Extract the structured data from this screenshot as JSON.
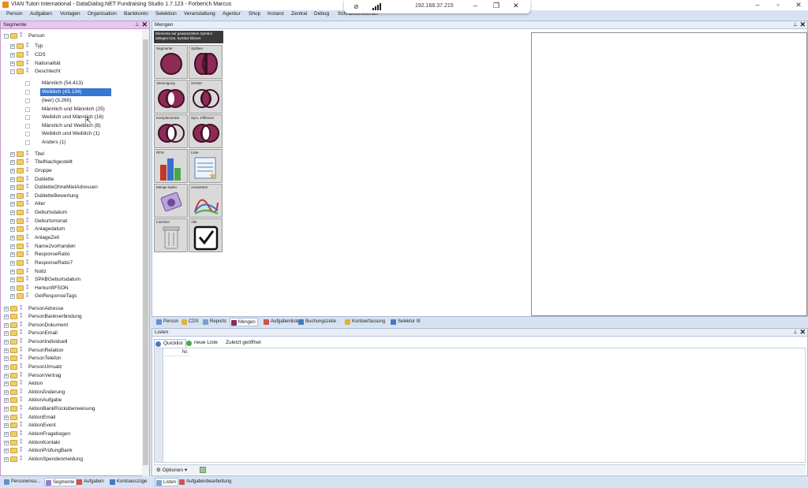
{
  "window": {
    "title": "VIAN Tutori International - DataDialog.NET Fundraising Studio 1.7.123 - Forberich Marcus"
  },
  "menu": [
    "Person",
    "Aufgaben",
    "Vorlagen",
    "Organisation",
    "Bankkonto",
    "Selektion",
    "Veranstaltung",
    "Agentur",
    "Shop",
    "Instanz",
    "Zentral",
    "Debug",
    "Schnellfunktionen"
  ],
  "remote": {
    "ip": "192.168.37.215"
  },
  "segmente": {
    "title": "Segmente",
    "tree": [
      {
        "label": "Person",
        "level": 0,
        "exp": "-"
      },
      {
        "label": "Typ",
        "level": 1,
        "exp": "+"
      },
      {
        "label": "CDS",
        "level": 1,
        "exp": "+"
      },
      {
        "label": "Nationalität",
        "level": 1,
        "exp": "+"
      },
      {
        "label": "Geschlecht",
        "level": 1,
        "exp": "-"
      },
      {
        "label": "Männlich (54.413)",
        "level": 2
      },
      {
        "label": "Weiblich (43.134)",
        "level": 2,
        "selected": true
      },
      {
        "label": "(leer) (3.260)",
        "level": 2
      },
      {
        "label": "Männlich und Männlich (25)",
        "level": 2
      },
      {
        "label": "Weiblich und Männlich (16)",
        "level": 2
      },
      {
        "label": "Männlich und Weiblich (8)",
        "level": 2
      },
      {
        "label": "Weiblich und Weiblich (1)",
        "level": 2
      },
      {
        "label": "Anders (1)",
        "level": 2
      },
      {
        "label": "Titel",
        "level": 1,
        "exp": "+"
      },
      {
        "label": "TitelNachgestellt",
        "level": 1,
        "exp": "+"
      },
      {
        "label": "Gruppe",
        "level": 1,
        "exp": "+"
      },
      {
        "label": "Dublette",
        "level": 1,
        "exp": "+"
      },
      {
        "label": "DubletteOhneMietAdressen",
        "level": 1,
        "exp": "+"
      },
      {
        "label": "DubletteBewertung",
        "level": 1,
        "exp": "+"
      },
      {
        "label": "Alter",
        "level": 1,
        "exp": "+"
      },
      {
        "label": "Geburtsdatum",
        "level": 1,
        "exp": "+"
      },
      {
        "label": "Geburtsmonat",
        "level": 1,
        "exp": "+"
      },
      {
        "label": "Anlagedatum",
        "level": 1,
        "exp": "+"
      },
      {
        "label": "AnlageZeit",
        "level": 1,
        "exp": "+"
      },
      {
        "label": "Name2vorhanden",
        "level": 1,
        "exp": "+"
      },
      {
        "label": "ResponseRatio",
        "level": 1,
        "exp": "+"
      },
      {
        "label": "ResponseRatio7",
        "level": 1,
        "exp": "+"
      },
      {
        "label": "Notiz",
        "level": 1,
        "exp": "+"
      },
      {
        "label": "SPABGeburtsdatum",
        "level": 1,
        "exp": "+"
      },
      {
        "label": "HerkunftFSON",
        "level": 1,
        "exp": "+"
      },
      {
        "label": "GetResponseTags",
        "level": 1,
        "exp": "+"
      },
      {
        "label": "PersonAdresse",
        "level": 0,
        "exp": "+"
      },
      {
        "label": "PersonBankverbindung",
        "level": 0,
        "exp": "+"
      },
      {
        "label": "PersonDokument",
        "level": 0,
        "exp": "+"
      },
      {
        "label": "PersonEmail",
        "level": 0,
        "exp": "+"
      },
      {
        "label": "PersonIndividuell",
        "level": 0,
        "exp": "+"
      },
      {
        "label": "PersonRelation",
        "level": 0,
        "exp": "+"
      },
      {
        "label": "PersonTelefon",
        "level": 0,
        "exp": "+"
      },
      {
        "label": "PersonUmsatz",
        "level": 0,
        "exp": "+"
      },
      {
        "label": "PersonVertrag",
        "level": 0,
        "exp": "+"
      },
      {
        "label": "Aktion",
        "level": 0,
        "exp": "+"
      },
      {
        "label": "AktionÄnderung",
        "level": 0,
        "exp": "+"
      },
      {
        "label": "AktionAufgabe",
        "level": 0,
        "exp": "+"
      },
      {
        "label": "AktionBankRücküberweisung",
        "level": 0,
        "exp": "+"
      },
      {
        "label": "AktionEmail",
        "level": 0,
        "exp": "+"
      },
      {
        "label": "AktionEvent",
        "level": 0,
        "exp": "+"
      },
      {
        "label": "AktionFragebogen",
        "level": 0,
        "exp": "+"
      },
      {
        "label": "AktionKontakt",
        "level": 0,
        "exp": "+"
      },
      {
        "label": "AktionPrüfungBank",
        "level": 0,
        "exp": "+"
      },
      {
        "label": "AktionSpendenmeldung",
        "level": 0,
        "exp": "+"
      }
    ]
  },
  "leftTabs": [
    {
      "label": "Personensu...",
      "color": "#6a8fc9"
    },
    {
      "label": "Segmente",
      "color": "#9a7ec1",
      "active": true
    },
    {
      "label": "Aufgaben",
      "color": "#d0524a"
    },
    {
      "label": "Kontoauszüge",
      "color": "#4a78c0"
    }
  ],
  "mengen": {
    "title": "Mengen",
    "tooltip": "Elemente auf gewünschtem Symbol ablegen bzw. Symbol klicken",
    "tools": [
      {
        "label": "Segmente",
        "icon": "circle"
      },
      {
        "label": "Spiltten",
        "icon": "split"
      },
      {
        "label": "Vereinigung",
        "icon": "union"
      },
      {
        "label": "Schnitt",
        "icon": "intersect"
      },
      {
        "label": "Komplementär",
        "icon": "complement"
      },
      {
        "label": "Sym. Differenz",
        "icon": "symdiff"
      },
      {
        "label": "RFM",
        "icon": "bars"
      },
      {
        "label": "Liste",
        "icon": "list"
      },
      {
        "label": "Menge laden",
        "icon": "load"
      },
      {
        "label": "Auswerten",
        "icon": "curves"
      },
      {
        "label": "Löschen",
        "icon": "trash"
      },
      {
        "label": "Alle",
        "icon": "check"
      }
    ]
  },
  "midTabs": [
    {
      "label": "Person",
      "color": "#6a8fc9"
    },
    {
      "label": "CDS",
      "color": "#e0b23a"
    },
    {
      "label": "Reports",
      "color": "#7aa0d0"
    },
    {
      "label": "Mengen",
      "color": "#8e2a56",
      "active": true
    },
    {
      "label": "Aufgabenliste",
      "color": "#d0524a"
    },
    {
      "label": "Buchungszeile",
      "color": "#4a78c0"
    },
    {
      "label": "Kontoerfassung",
      "color": "#e0b23a"
    },
    {
      "label": "Selektor III",
      "color": "#4a78c0"
    }
  ],
  "listen": {
    "title": "Listen",
    "tabs": [
      {
        "label": "Quicklist",
        "color": "#4a78c0",
        "active": true
      },
      {
        "label": "neue Liste",
        "color": "#4aa84a"
      },
      {
        "label": "Zuletzt geöffnet",
        "color": ""
      }
    ],
    "column": "Nr.",
    "options_label": "Optionen"
  },
  "bottomTabs": [
    {
      "label": "Listen",
      "color": "#7aa0d0",
      "active": true
    },
    {
      "label": "Aufgabenbearbeitung",
      "color": "#d0524a"
    }
  ]
}
